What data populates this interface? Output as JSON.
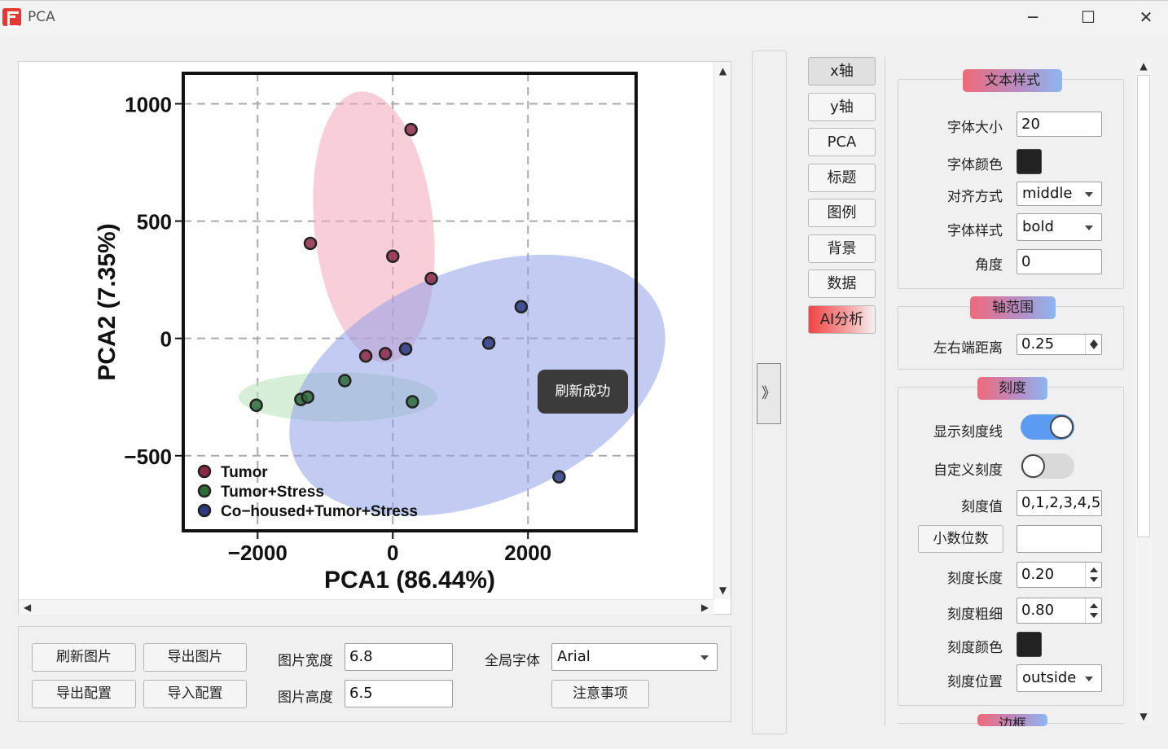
{
  "window": {
    "title": "PCA",
    "minimize": "─",
    "maximize": "☐",
    "close": "✕"
  },
  "chart_data": {
    "type": "scatter",
    "title": "",
    "xlabel": "PCA1 (86.44%)",
    "ylabel": "PCA2 (7.35%)",
    "xlim": [
      -3100,
      3600
    ],
    "ylim": [
      -820,
      1130
    ],
    "xticks": [
      {
        "v": -2000,
        "label": "−2000"
      },
      {
        "v": 0,
        "label": "0"
      },
      {
        "v": 2000,
        "label": "2000"
      }
    ],
    "yticks": [
      {
        "v": 1000,
        "label": "1000"
      },
      {
        "v": 500,
        "label": "500"
      },
      {
        "v": 0,
        "label": "0"
      },
      {
        "v": -500,
        "label": "−500"
      }
    ],
    "grid": true,
    "legend_position": "bottom-left",
    "series": [
      {
        "name": "Tumor",
        "color": "#8b2a45",
        "points": [
          [
            270,
            890
          ],
          [
            -1220,
            405
          ],
          [
            0,
            350
          ],
          [
            570,
            255
          ],
          [
            -400,
            -75
          ],
          [
            -110,
            -65
          ]
        ],
        "ellipse": {
          "cx": -280,
          "cy": 475,
          "rx": 880,
          "ry": 580,
          "angle": -6,
          "fill": "#f3a6b8"
        }
      },
      {
        "name": "Tumor+Stress",
        "color": "#2e6b3a",
        "points": [
          [
            -2020,
            -285
          ],
          [
            -1360,
            -260
          ],
          [
            -1260,
            -250
          ],
          [
            -710,
            -180
          ],
          [
            290,
            -270
          ]
        ],
        "ellipse": {
          "cx": -810,
          "cy": -250,
          "rx": 1470,
          "ry": 105,
          "angle": 0,
          "fill": "#b7e0b6"
        }
      },
      {
        "name": "Co−housed+Tumor+Stress",
        "color": "#2c3a80",
        "points": [
          [
            1900,
            135
          ],
          [
            1420,
            -20
          ],
          [
            190,
            -45
          ],
          [
            2460,
            -590
          ]
        ],
        "ellipse": {
          "cx": 1250,
          "cy": -200,
          "rx": 1720,
          "ry": 840,
          "angle": 68,
          "fill": "#8fa0e8"
        }
      }
    ]
  },
  "toast": "刷新成功",
  "bottom": {
    "refresh": "刷新图片",
    "export_image": "导出图片",
    "export_config": "导出配置",
    "import_config": "导入配置",
    "width_label": "图片宽度",
    "width_value": "6.8",
    "height_label": "图片高度",
    "height_value": "6.5",
    "font_label": "全局字体",
    "font_value": "Arial",
    "notes": "注意事项"
  },
  "collapse_icon": "》",
  "tabs": [
    "x轴",
    "y轴",
    "PCA",
    "标题",
    "图例",
    "背景",
    "数据",
    "AI分析"
  ],
  "text_style": {
    "header": "文本样式",
    "font_size_label": "字体大小",
    "font_size": "20",
    "font_color_label": "字体颜色",
    "font_color": "#222222",
    "align_label": "对齐方式",
    "align": "middle",
    "style_label": "字体样式",
    "style": "bold",
    "angle_label": "角度",
    "angle": "0"
  },
  "axis_range": {
    "header": "轴范围",
    "margin_label": "左右端距离",
    "margin": "0.25"
  },
  "ticks": {
    "header": "刻度",
    "show_label": "显示刻度线",
    "show": true,
    "custom_label": "自定义刻度",
    "custom": false,
    "values_label": "刻度值",
    "values": "0,1,2,3,4,5",
    "decimals_button": "小数位数",
    "decimals": "",
    "length_label": "刻度长度",
    "length": "0.20",
    "width_label": "刻度粗细",
    "width": "0.80",
    "color_label": "刻度颜色",
    "color": "#222222",
    "position_label": "刻度位置",
    "position": "outside"
  },
  "border": {
    "header": "边框"
  },
  "colors": {
    "toggle_on": "#5b9cf2",
    "toggle_off": "#d9d9d9",
    "accent": "#ef4444"
  }
}
